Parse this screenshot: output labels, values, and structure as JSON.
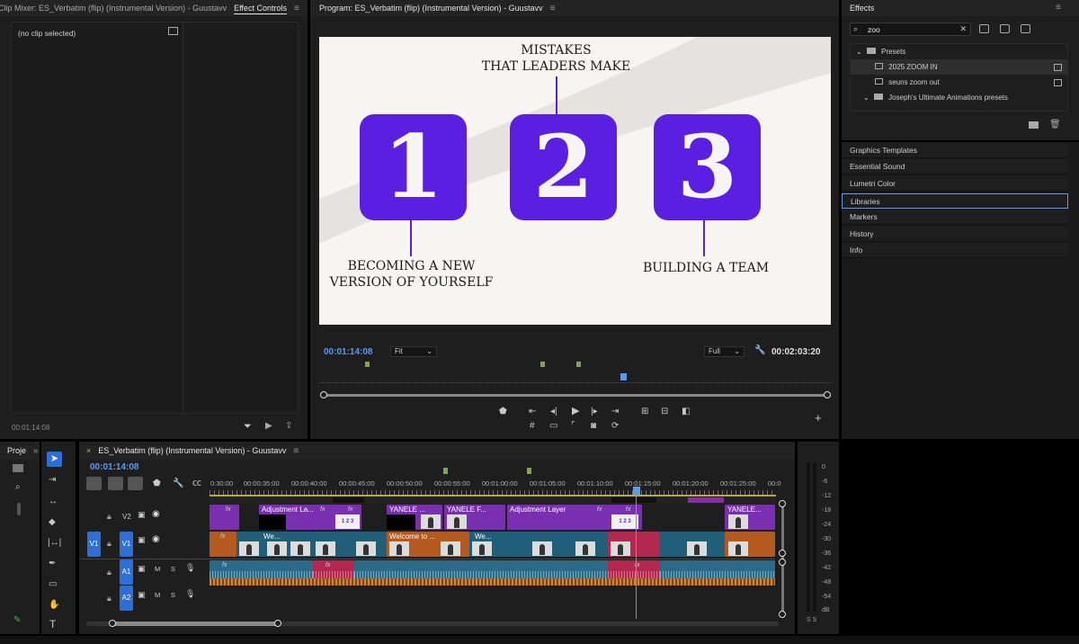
{
  "source_panel": {
    "tabs": [
      "Clip Mixer: ES_Verbatim (flip) (Instrumental Version) - Guustavv",
      "Effect Controls"
    ],
    "active_tab": "Effect Controls",
    "no_clip_text": "(no clip selected)",
    "timecode": "00:01:14:08"
  },
  "program_monitor": {
    "title": "Program: ES_Verbatim (flip) (Instrumental Version) - Guustavv",
    "current_timecode": "00:01:14:08",
    "duration_timecode": "00:02:03:20",
    "fit_select": "Fit",
    "quality_select": "Full",
    "frame": {
      "headline_line1": "MISTAKES",
      "headline_line2": "THAT LEADERS MAKE",
      "numbers": [
        "1",
        "2",
        "3"
      ],
      "caption_left_line1": "BECOMING A NEW",
      "caption_left_line2": "VERSION OF YOURSELF",
      "caption_right": "BUILDING A TEAM",
      "accent_color": "#5a1fe0"
    }
  },
  "effects_panel": {
    "title": "Effects",
    "search_value": "zoo",
    "tree": [
      {
        "label": "Presets",
        "type": "folder"
      },
      {
        "label": "2025 ZOOM IN",
        "type": "preset"
      },
      {
        "label": "seuns zoom out",
        "type": "preset"
      },
      {
        "label": "Joseph's Ultimate Animations presets",
        "type": "folder"
      }
    ]
  },
  "side_panels": [
    "Graphics Templates",
    "Essential Sound",
    "Lumetri Color",
    "Libraries",
    "Markers",
    "History",
    "Info"
  ],
  "selected_side_panel": "Libraries",
  "project_panel": {
    "tab": "Proje"
  },
  "timeline": {
    "sequence_title": "ES_Verbatim (flip) (Instrumental Version) - Guustavv",
    "timecode": "00:01:14:08",
    "ruler": [
      "0:30:00",
      "00:00:35:00",
      "00:00:40:00",
      "00:00:45:00",
      "00:00:50:00",
      "00:00:55:00",
      "00:01:00:00",
      "00:01:05:00",
      "00:01:10:00",
      "00:01:15:00",
      "00:01:20:00",
      "00:01:25:00",
      "00:0"
    ],
    "tracks": {
      "v2": "V2",
      "v1": "V1",
      "v1_source": "V1",
      "a1": "A1",
      "a2": "A2",
      "mute": "M",
      "solo": "S"
    },
    "v2_clips": [
      "Adjustment La...",
      "YANELE ...",
      "YANELE F...",
      "Adjustment Layer",
      "YANELE..."
    ],
    "v1_clips": [
      "We...",
      "Welcome to ...",
      "We..."
    ],
    "clip_badge": "1 2 3"
  },
  "audio_meter": {
    "scale": [
      "0",
      "-6",
      "-12",
      "-18",
      "-24",
      "-30",
      "-36",
      "-42",
      "-48",
      "-54",
      "dB"
    ],
    "solo_buttons": "S S"
  },
  "colors": {
    "playhead": "#5a9bf0",
    "v2_adjustment": "#7a2fb0",
    "v1_clip": "#1f5f7a",
    "v1_orange": "#b55a1f",
    "audio_blue": "#2b6b88",
    "audio_pink": "#b2284f"
  }
}
